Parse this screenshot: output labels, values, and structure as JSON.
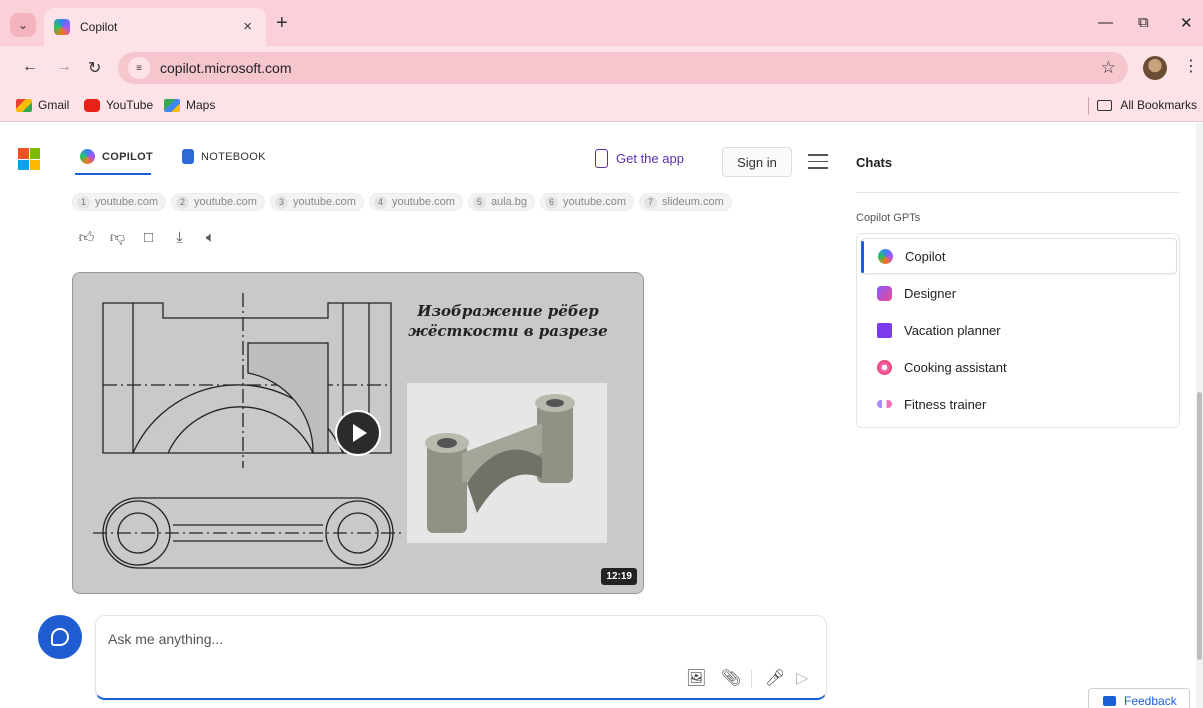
{
  "browser": {
    "tab_title": "Copilot",
    "tab_close": "×",
    "new_tab": "+",
    "url": "copilot.microsoft.com",
    "bookmarks": [
      "Gmail",
      "YouTube",
      "Maps"
    ],
    "all_bookmarks": "All Bookmarks"
  },
  "header": {
    "tabs": [
      "COPILOT",
      "NOTEBOOK"
    ],
    "get_app": "Get the app",
    "sign_in": "Sign in"
  },
  "citations": [
    {
      "num": "1",
      "label": "youtube.com"
    },
    {
      "num": "2",
      "label": "youtube.com"
    },
    {
      "num": "3",
      "label": "youtube.com"
    },
    {
      "num": "4",
      "label": "youtube.com"
    },
    {
      "num": "5",
      "label": "aula.bg"
    },
    {
      "num": "6",
      "label": "youtube.com"
    },
    {
      "num": "7",
      "label": "slideum.com"
    }
  ],
  "video": {
    "title_line1": "Изображение рёбер",
    "title_line2": "жёсткости в разрезе",
    "duration": "12:19"
  },
  "composer": {
    "placeholder": "Ask me anything..."
  },
  "sidebar": {
    "chats_label": "Chats",
    "gpts_label": "Copilot GPTs",
    "gpts": [
      "Copilot",
      "Designer",
      "Vacation planner",
      "Cooking assistant",
      "Fitness trainer"
    ]
  },
  "feedback": "Feedback",
  "colors": {
    "accent": "#1a5fd6",
    "browser_frame": "#fbd0d8",
    "get_app": "#5a2fb0"
  },
  "icons": [
    "chevron-down-icon",
    "back-icon",
    "forward-icon",
    "reload-icon",
    "site-info-icon",
    "star-icon",
    "thumbs-up-icon",
    "thumbs-down-icon",
    "copy-icon",
    "download-icon",
    "speaker-icon",
    "play-icon",
    "image-upload-icon",
    "attach-icon",
    "mic-icon",
    "send-icon"
  ]
}
